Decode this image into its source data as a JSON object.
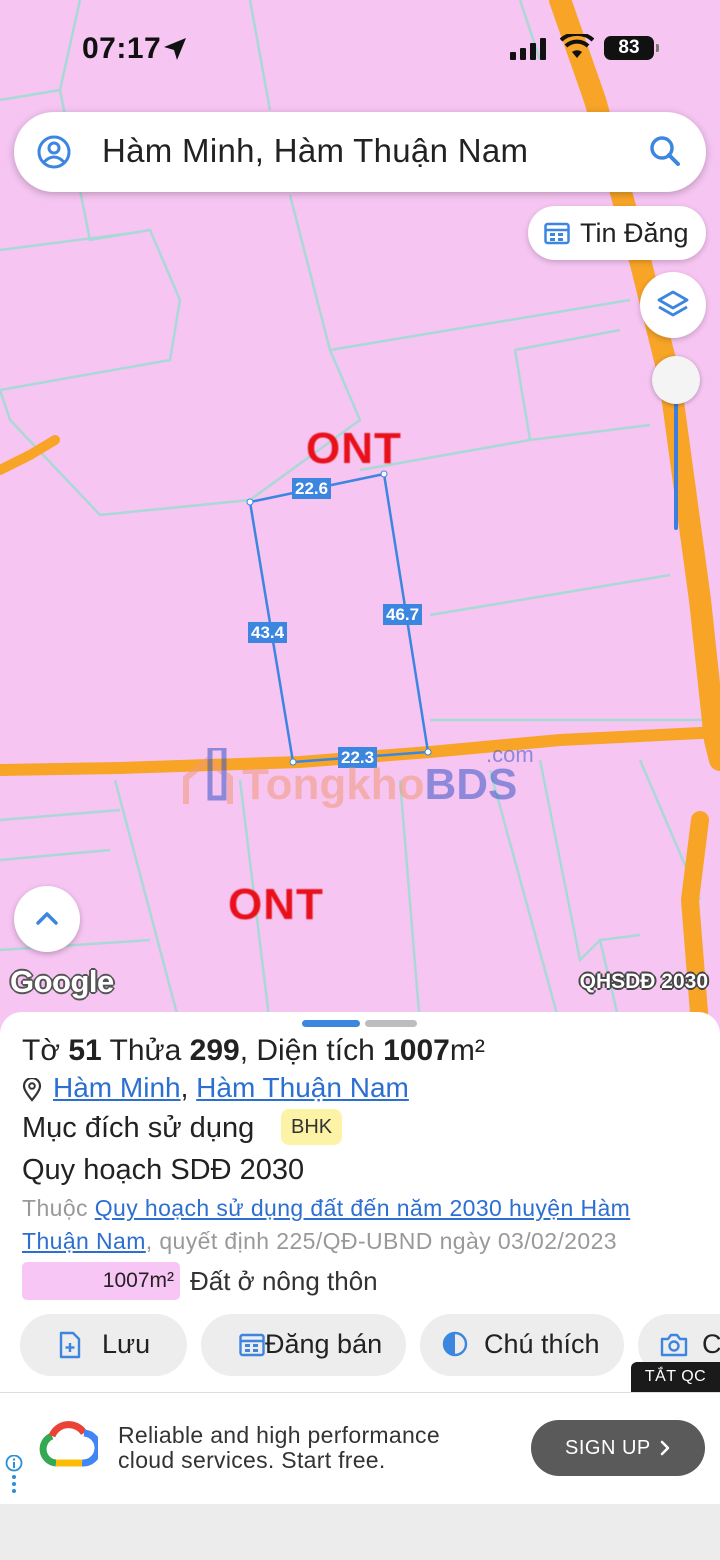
{
  "status_bar": {
    "time": "07:17",
    "battery": "83"
  },
  "search": {
    "query": "Hàm Minh, Hàm Thuận Nam"
  },
  "map": {
    "tin_dang_label": "Tin Đăng",
    "zone_label_top": "ONT",
    "zone_label_bottom": "ONT",
    "dimensions": {
      "top": "22.6",
      "left": "43.4",
      "right": "46.7",
      "bottom": "22.3"
    },
    "watermark": {
      "brand_a": "Tongkho",
      "brand_b": "BDS",
      "suffix": ".com"
    },
    "google_label": "Google",
    "layer_label": "QHSDĐ 2030"
  },
  "parcel": {
    "sheet_label": "Tờ",
    "sheet_no": "51",
    "lot_label": "Thửa",
    "lot_no": "299",
    "area_label": ", Diện tích",
    "area": "1007",
    "area_unit": "m²",
    "commune": "Hàm Minh",
    "district": "Hàm Thuận Nam",
    "purpose_label": "Mục đích sử dụng",
    "purpose_code": "BHK",
    "plan_title": "Quy hoạch SDĐ 2030",
    "plan_prefix": "Thuộc ",
    "plan_link": "Quy hoạch sử dụng đất đến năm 2030 huyện Hàm Thuận Nam",
    "plan_suffix": ", quyết định 225/QĐ-UBND ngày 03/02/2023",
    "legend_area": "1007m²",
    "legend_label": "Đất ở nông thôn"
  },
  "actions": [
    {
      "label": "Lưu",
      "icon": "save-file-icon"
    },
    {
      "label": "Đăng bán",
      "icon": "calendar-icon"
    },
    {
      "label": "Chú thích",
      "icon": "contrast-icon"
    },
    {
      "label": "C",
      "icon": "camera-icon"
    }
  ],
  "ad": {
    "close_label": "TẮT QC",
    "line1": "Reliable and high performance",
    "line2": "cloud services. Start free.",
    "cta": "SIGN UP"
  },
  "colors": {
    "accent": "#3c86e0",
    "zone": "#f6c5f2",
    "road": "#f7a427",
    "zone_label": "#e8111b"
  }
}
